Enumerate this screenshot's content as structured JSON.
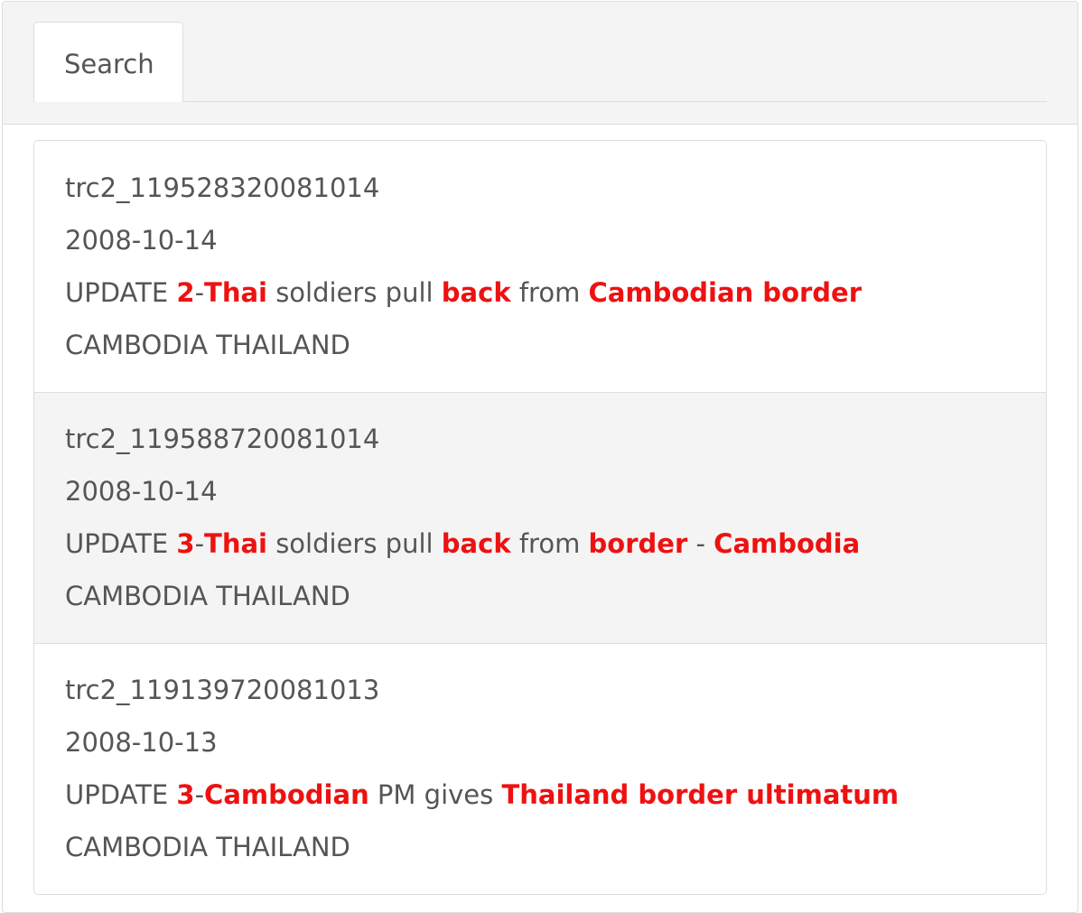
{
  "tabs": [
    {
      "label": "Search"
    }
  ],
  "colors": {
    "highlight": "#ee1111",
    "text": "#555555",
    "alt_row_bg": "#f4f4f4",
    "header_bg": "#f4f4f4",
    "border": "#dddddd"
  },
  "results": [
    {
      "id": "trc2_119528320081014",
      "date": "2008-10-14",
      "headline": [
        {
          "text": "UPDATE ",
          "hl": false
        },
        {
          "text": "2",
          "hl": true
        },
        {
          "text": "-",
          "hl": false
        },
        {
          "text": "Thai",
          "hl": true
        },
        {
          "text": " soldiers pull ",
          "hl": false
        },
        {
          "text": "back",
          "hl": true
        },
        {
          "text": " from ",
          "hl": false
        },
        {
          "text": "Cambodian border",
          "hl": true
        }
      ],
      "countries": "CAMBODIA THAILAND"
    },
    {
      "id": "trc2_119588720081014",
      "date": "2008-10-14",
      "headline": [
        {
          "text": "UPDATE ",
          "hl": false
        },
        {
          "text": "3",
          "hl": true
        },
        {
          "text": "-",
          "hl": false
        },
        {
          "text": "Thai",
          "hl": true
        },
        {
          "text": " soldiers pull ",
          "hl": false
        },
        {
          "text": "back",
          "hl": true
        },
        {
          "text": " from ",
          "hl": false
        },
        {
          "text": "border",
          "hl": true
        },
        {
          "text": " - ",
          "hl": false
        },
        {
          "text": "Cambodia",
          "hl": true
        }
      ],
      "countries": "CAMBODIA THAILAND"
    },
    {
      "id": "trc2_119139720081013",
      "date": "2008-10-13",
      "headline": [
        {
          "text": "UPDATE ",
          "hl": false
        },
        {
          "text": "3",
          "hl": true
        },
        {
          "text": "-",
          "hl": false
        },
        {
          "text": "Cambodian",
          "hl": true
        },
        {
          "text": " PM gives ",
          "hl": false
        },
        {
          "text": "Thailand border ultimatum",
          "hl": true
        }
      ],
      "countries": "CAMBODIA THAILAND"
    }
  ]
}
